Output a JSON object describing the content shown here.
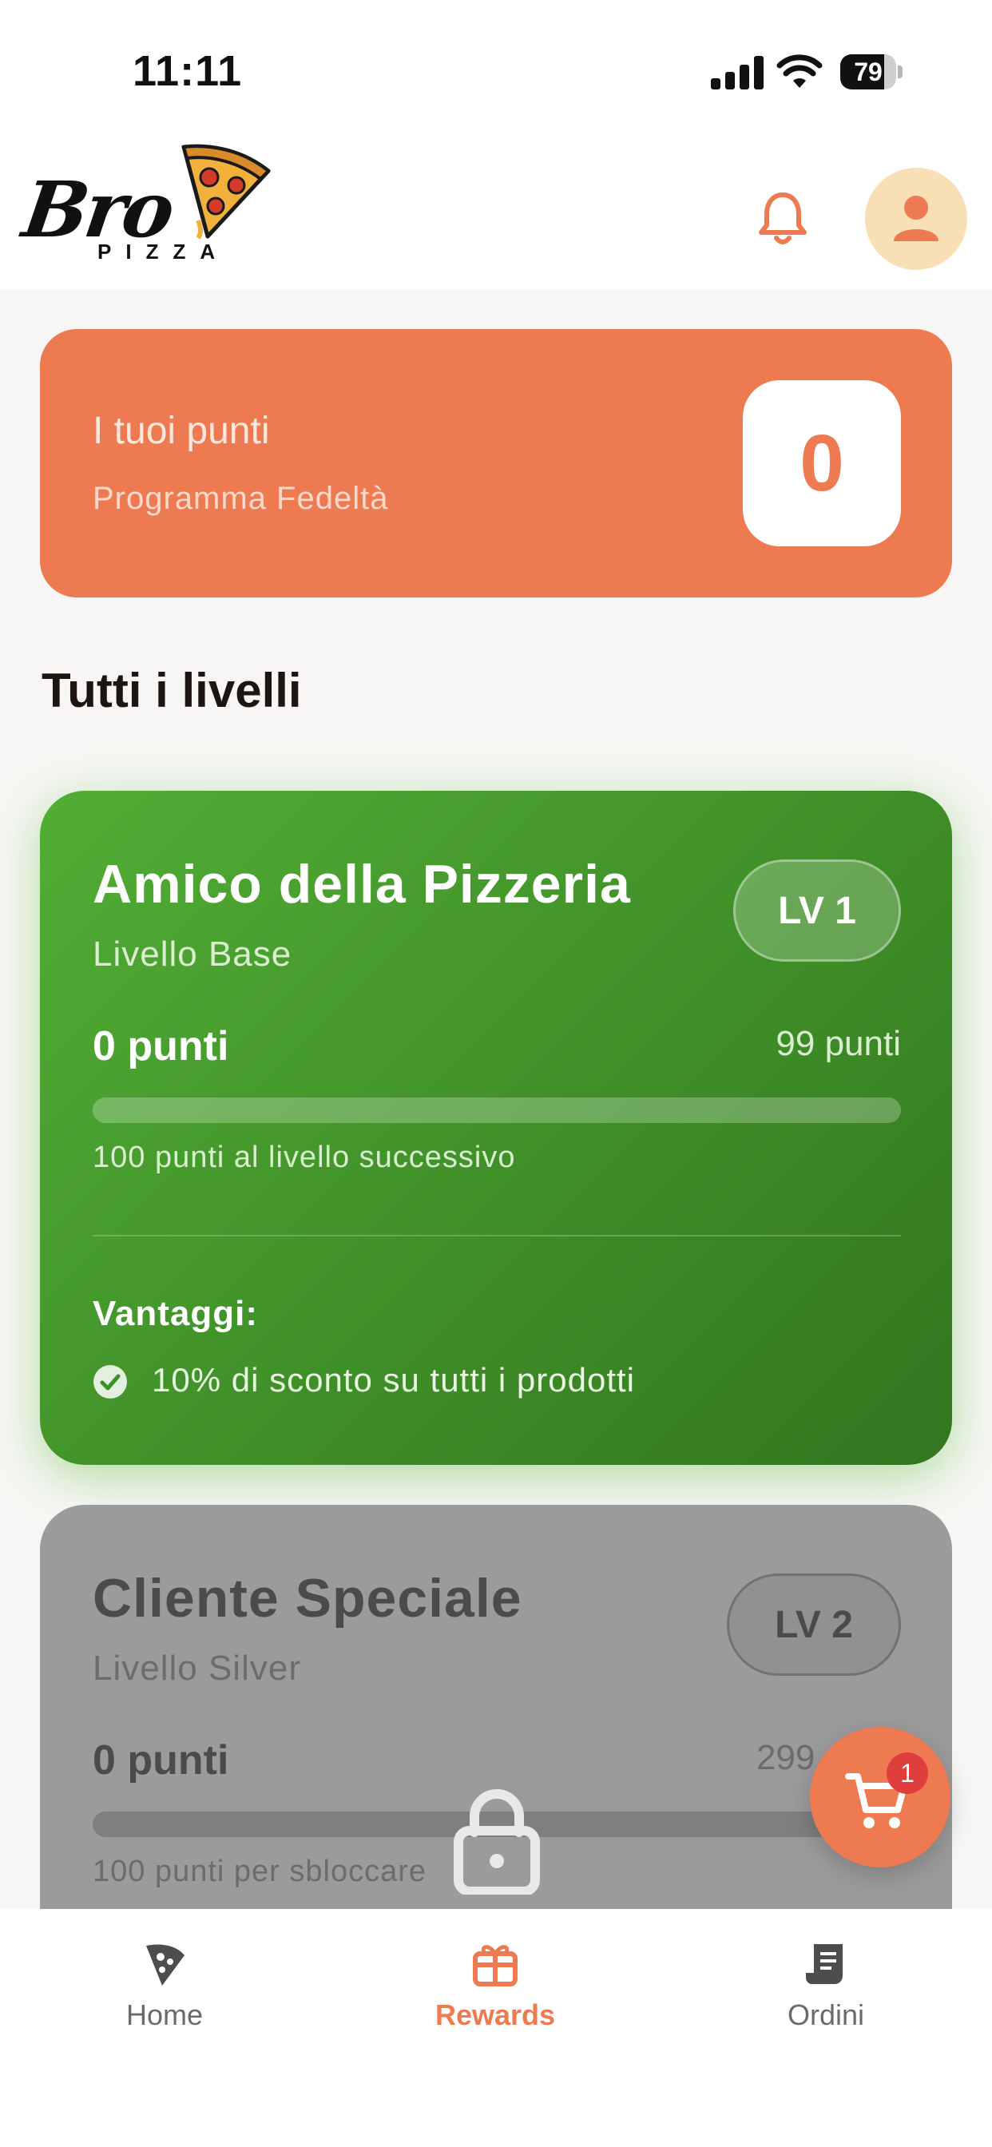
{
  "status_bar": {
    "time": "11:11",
    "battery": "79"
  },
  "header": {
    "logo": {
      "script": "Bro",
      "subtitle": "PIZZA"
    },
    "icons": [
      "bell-icon",
      "person-icon"
    ]
  },
  "points_card": {
    "title": "I tuoi punti",
    "subtitle": "Programma Fedeltà",
    "points": "0"
  },
  "section_title": "Tutti i livelli",
  "levels": [
    {
      "name": "Amico della Pizzeria",
      "tier": "Livello Base",
      "badge": "LV 1",
      "points": "0 punti",
      "max_points": "99 punti",
      "progress": 0,
      "next_text": "100 punti al livello successivo",
      "perks_title": "Vantaggi:",
      "perks": [
        "10% di sconto su tutti i prodotti"
      ],
      "unlocked": true
    },
    {
      "name": "Cliente Speciale",
      "tier": "Livello Silver",
      "badge": "LV 2",
      "points": "0 punti",
      "max_points": "299 punti",
      "progress": 0,
      "next_text": "100 punti per sbloccare",
      "unlocked": false
    }
  ],
  "cart": {
    "count": "1"
  },
  "bottom_nav": {
    "items": [
      {
        "label": "Home",
        "icon": "pizza-slice-icon",
        "active": false
      },
      {
        "label": "Rewards",
        "icon": "gift-icon",
        "active": true
      },
      {
        "label": "Ordini",
        "icon": "receipt-icon",
        "active": false
      }
    ]
  },
  "colors": {
    "accent": "#ee7a52",
    "level1": "#4a9e30",
    "locked": "#9b9b9b",
    "badge": "#e03d3d",
    "background": "#f7f6f4"
  }
}
